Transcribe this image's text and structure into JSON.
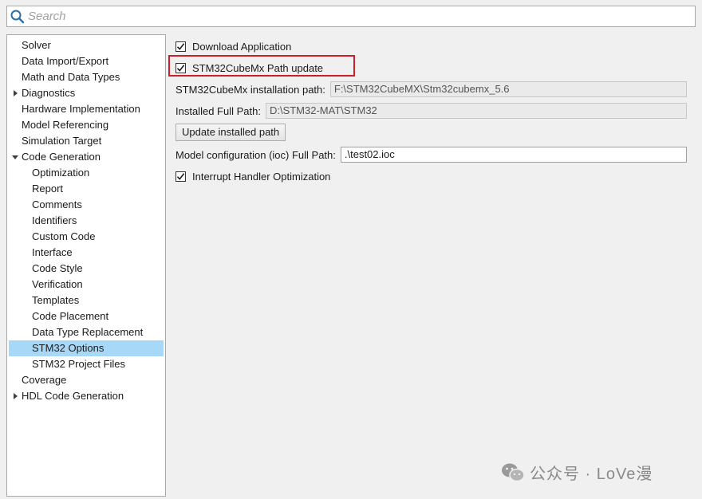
{
  "search": {
    "placeholder": "Search",
    "value": ""
  },
  "tree": {
    "items": [
      {
        "label": "Solver",
        "level": 0,
        "expander": "none",
        "selected": false
      },
      {
        "label": "Data Import/Export",
        "level": 0,
        "expander": "none",
        "selected": false
      },
      {
        "label": "Math and Data Types",
        "level": 0,
        "expander": "none",
        "selected": false
      },
      {
        "label": "Diagnostics",
        "level": 0,
        "expander": "collapsed",
        "selected": false
      },
      {
        "label": "Hardware Implementation",
        "level": 0,
        "expander": "none",
        "selected": false
      },
      {
        "label": "Model Referencing",
        "level": 0,
        "expander": "none",
        "selected": false
      },
      {
        "label": "Simulation Target",
        "level": 0,
        "expander": "none",
        "selected": false
      },
      {
        "label": "Code Generation",
        "level": 0,
        "expander": "expanded",
        "selected": false
      },
      {
        "label": "Optimization",
        "level": 1,
        "expander": "none",
        "selected": false
      },
      {
        "label": "Report",
        "level": 1,
        "expander": "none",
        "selected": false
      },
      {
        "label": "Comments",
        "level": 1,
        "expander": "none",
        "selected": false
      },
      {
        "label": "Identifiers",
        "level": 1,
        "expander": "none",
        "selected": false
      },
      {
        "label": "Custom Code",
        "level": 1,
        "expander": "none",
        "selected": false
      },
      {
        "label": "Interface",
        "level": 1,
        "expander": "none",
        "selected": false
      },
      {
        "label": "Code Style",
        "level": 1,
        "expander": "none",
        "selected": false
      },
      {
        "label": "Verification",
        "level": 1,
        "expander": "none",
        "selected": false
      },
      {
        "label": "Templates",
        "level": 1,
        "expander": "none",
        "selected": false
      },
      {
        "label": "Code Placement",
        "level": 1,
        "expander": "none",
        "selected": false
      },
      {
        "label": "Data Type Replacement",
        "level": 1,
        "expander": "none",
        "selected": false
      },
      {
        "label": "STM32 Options",
        "level": 1,
        "expander": "none",
        "selected": true
      },
      {
        "label": "STM32 Project Files",
        "level": 1,
        "expander": "none",
        "selected": false
      },
      {
        "label": "Coverage",
        "level": 0,
        "expander": "none",
        "selected": false
      },
      {
        "label": "HDL Code Generation",
        "level": 0,
        "expander": "collapsed",
        "selected": false
      }
    ]
  },
  "options": {
    "download_application": {
      "label": "Download Application",
      "checked": true
    },
    "path_update": {
      "label": "STM32CubeMx Path update",
      "checked": true
    },
    "installation_path": {
      "label": "STM32CubeMx installation path:",
      "value": "F:\\STM32CubeMX\\Stm32cubemx_5.6"
    },
    "installed_full_path": {
      "label": "Installed Full Path:",
      "value": "D:\\STM32-MAT\\STM32"
    },
    "update_button": "Update installed path",
    "ioc_path": {
      "label": "Model configuration (ioc) Full Path:",
      "value": ".\\test02.ioc"
    },
    "interrupt_optimization": {
      "label": "Interrupt Handler Optimization",
      "checked": true
    }
  },
  "watermark": {
    "text": "公众号 · LoVe漫"
  },
  "colors": {
    "selection": "#a8d8f8",
    "highlight_border": "#cc1f2a"
  }
}
